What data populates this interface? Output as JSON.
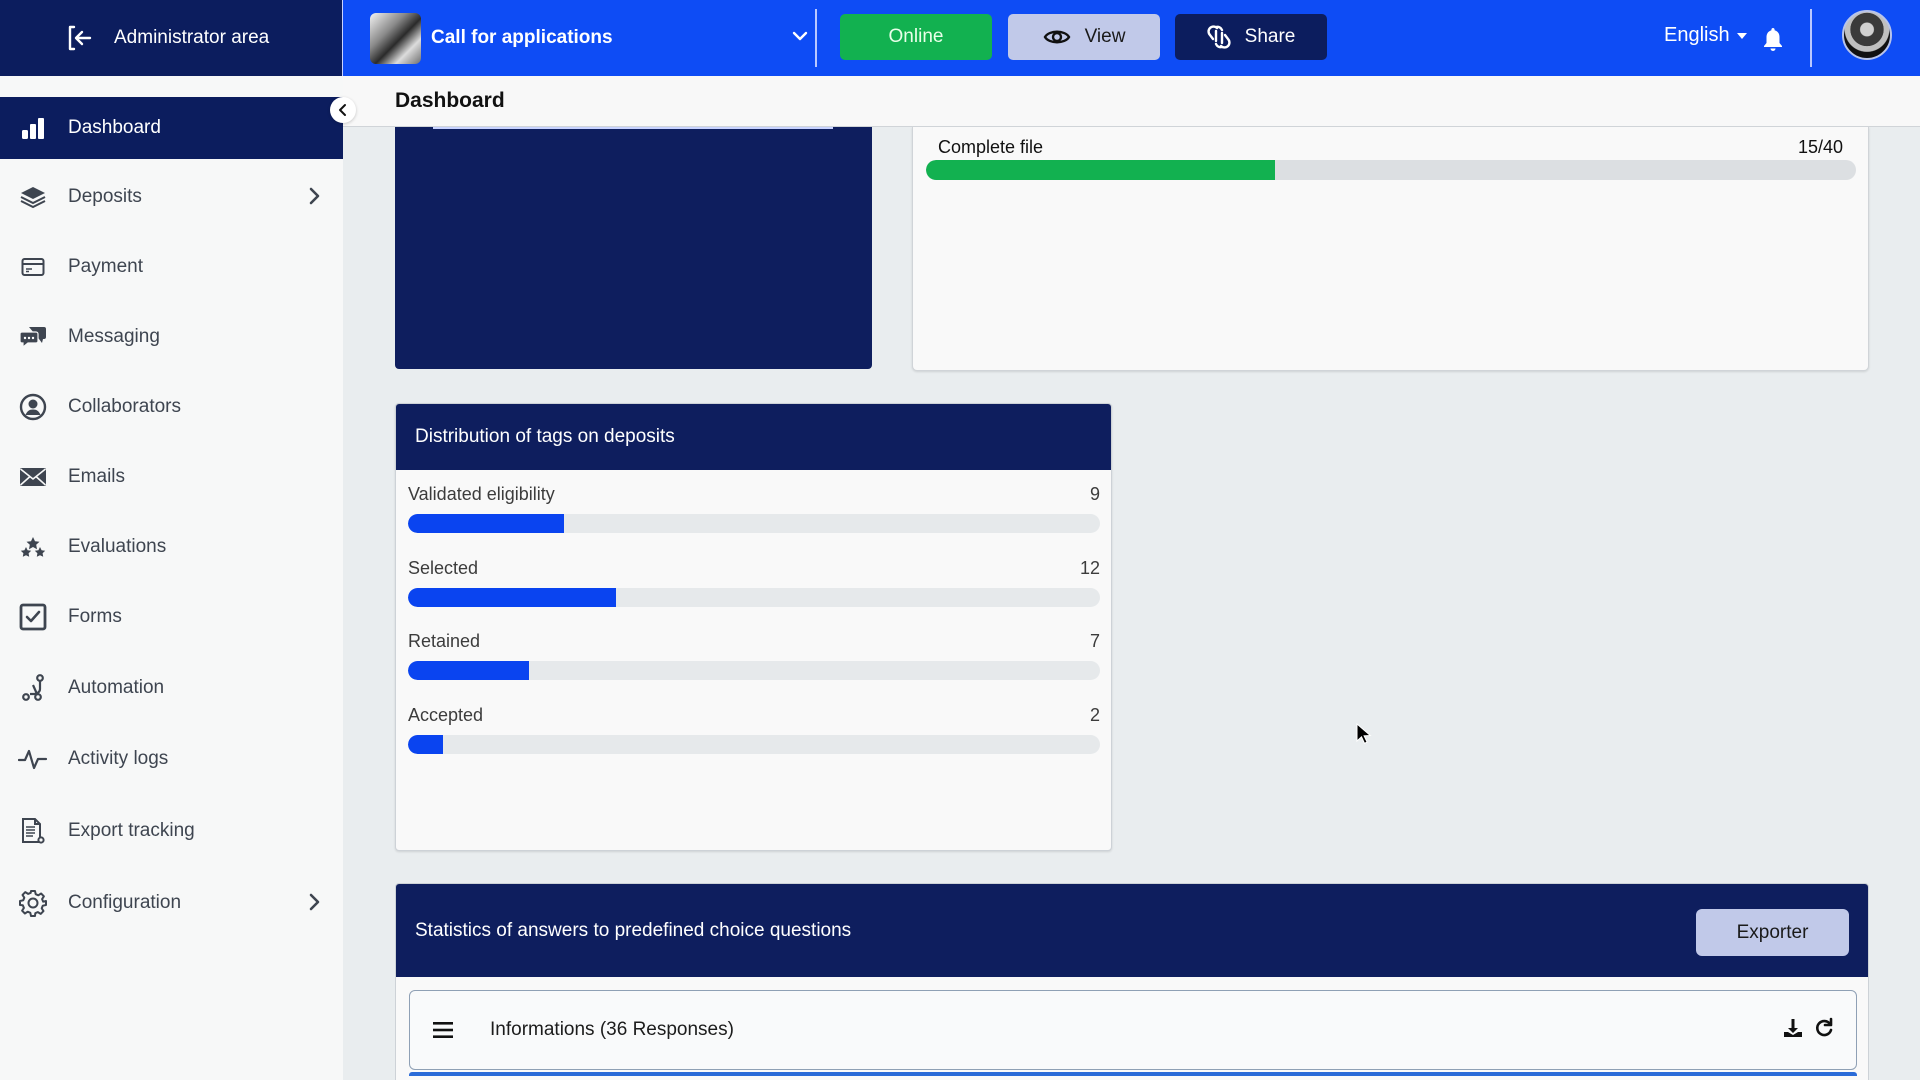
{
  "topbar": {
    "admin_area_label": "Administrator area",
    "campaign_title": "Call for applications",
    "status_button": "Online",
    "view_button": "View",
    "share_button": "Share",
    "language": "English",
    "colors": {
      "topbar": "#0e4cf5",
      "navy": "#0c1d5e",
      "online": "#12b150"
    }
  },
  "sidebar": {
    "items": [
      {
        "label": "Dashboard",
        "icon": "bar-chart-icon",
        "active": true
      },
      {
        "label": "Deposits",
        "icon": "layers-icon",
        "has_submenu": true
      },
      {
        "label": "Payment",
        "icon": "credit-card-icon"
      },
      {
        "label": "Messaging",
        "icon": "chat-bubbles-icon"
      },
      {
        "label": "Collaborators",
        "icon": "user-circle-icon"
      },
      {
        "label": "Emails",
        "icon": "envelope-icon"
      },
      {
        "label": "Evaluations",
        "icon": "stars-icon"
      },
      {
        "label": "Forms",
        "icon": "checkbox-icon"
      },
      {
        "label": "Automation",
        "icon": "workflow-icon"
      },
      {
        "label": "Activity logs",
        "icon": "pulse-icon"
      },
      {
        "label": "Export tracking",
        "icon": "document-export-icon"
      },
      {
        "label": "Configuration",
        "icon": "gear-icon",
        "has_submenu": true
      }
    ]
  },
  "page": {
    "title": "Dashboard"
  },
  "progress": {
    "label": "Complete file",
    "value_text": "15/40",
    "value": 15,
    "max": 40
  },
  "tags": {
    "title": "Distribution of tags on deposits",
    "max": 40,
    "items": [
      {
        "label": "Validated eligibility",
        "value": 9
      },
      {
        "label": "Selected",
        "value": 12
      },
      {
        "label": "Retained",
        "value": 7
      },
      {
        "label": "Accepted",
        "value": 2
      }
    ]
  },
  "stats": {
    "title": "Statistics of answers to predefined choice questions",
    "export_button": "Exporter",
    "sections": [
      {
        "title": "Informations (36 Responses)"
      }
    ]
  }
}
